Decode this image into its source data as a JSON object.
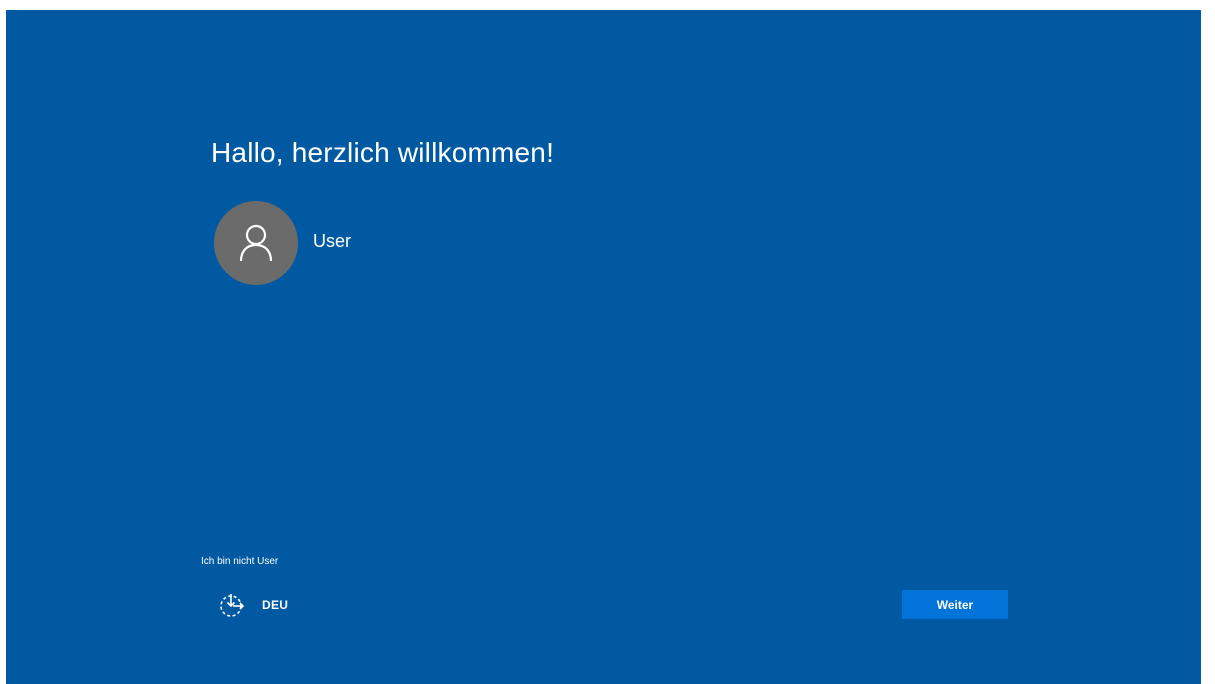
{
  "welcome": {
    "title": "Hallo, herzlich willkommen!"
  },
  "account": {
    "name": "User",
    "avatar_icon": "user-icon"
  },
  "footer": {
    "not_user_link": "Ich bin nicht User",
    "accessibility_icon": "ease-of-access-icon",
    "language": "DEU",
    "next_label": "Weiter"
  },
  "colors": {
    "background": "#015aa1",
    "avatar": "#6b6b6b",
    "accent_button": "#0173d9",
    "text": "#ffffff"
  }
}
